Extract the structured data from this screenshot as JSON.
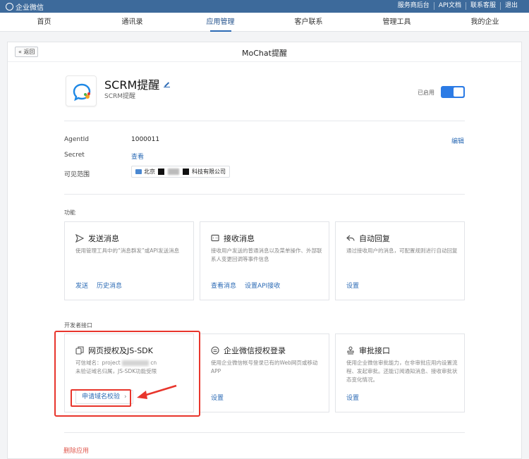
{
  "topbar": {
    "brand": "企业微信",
    "links": [
      "服务商后台",
      "API文档",
      "联系客服",
      "退出"
    ]
  },
  "nav": {
    "items": [
      "首页",
      "通讯录",
      "应用管理",
      "客户联系",
      "管理工具",
      "我的企业"
    ],
    "active_index": 2
  },
  "panel": {
    "back_label": "« 返回",
    "title": "MoChat提醒"
  },
  "app": {
    "name": "SCRM提醒",
    "subtitle": "SCRM提醒",
    "status_label": "已启用",
    "enabled": true
  },
  "details": {
    "agentid_label": "AgentId",
    "agentid_value": "1000011",
    "edit_label": "编辑",
    "secret_label": "Secret",
    "secret_link": "查看",
    "scope_label": "可见范围",
    "scope_prefix": "北京",
    "scope_suffix": "科技有限公司"
  },
  "features": {
    "section_label": "功能",
    "cards": [
      {
        "title": "发送消息",
        "desc": "使用管理工具中的“消息群发”或API发送消息",
        "links": [
          "发送",
          "历史消息"
        ]
      },
      {
        "title": "接收消息",
        "desc": "接收用户发送的普通消息以及菜单操作、外部联系人变更回调等事件信息",
        "links": [
          "查看消息",
          "设置API接收"
        ]
      },
      {
        "title": "自动回复",
        "desc": "通过接收用户的消息，可配置规则进行自动回复",
        "links": [
          "设置"
        ]
      }
    ]
  },
  "developer": {
    "section_label": "开发者接口",
    "cards": [
      {
        "title": "网页授权及JS-SDK",
        "desc_line1_prefix": "可信域名：project",
        "desc_line1_suffix": "cn",
        "desc_line2": "未验证域名归属，JS-SDK功能受限",
        "button": "申请域名校验"
      },
      {
        "title": "企业微信授权登录",
        "desc": "使用企业微信帐号登录已有的Web网页或移动APP",
        "links": [
          "设置"
        ]
      },
      {
        "title": "审批接口",
        "desc": "使用企业微信审批能力，在非审批应用内设置流程、发起审批。还能订阅通知消息、接收审批状态变化情况。",
        "links": [
          "设置"
        ]
      }
    ]
  },
  "delete_label": "删除应用",
  "colors": {
    "brand": "#3d6a9b",
    "link": "#2c6bb5",
    "toggle": "#2c7be5",
    "annotation": "#e8352c",
    "danger": "#e05a4f"
  }
}
